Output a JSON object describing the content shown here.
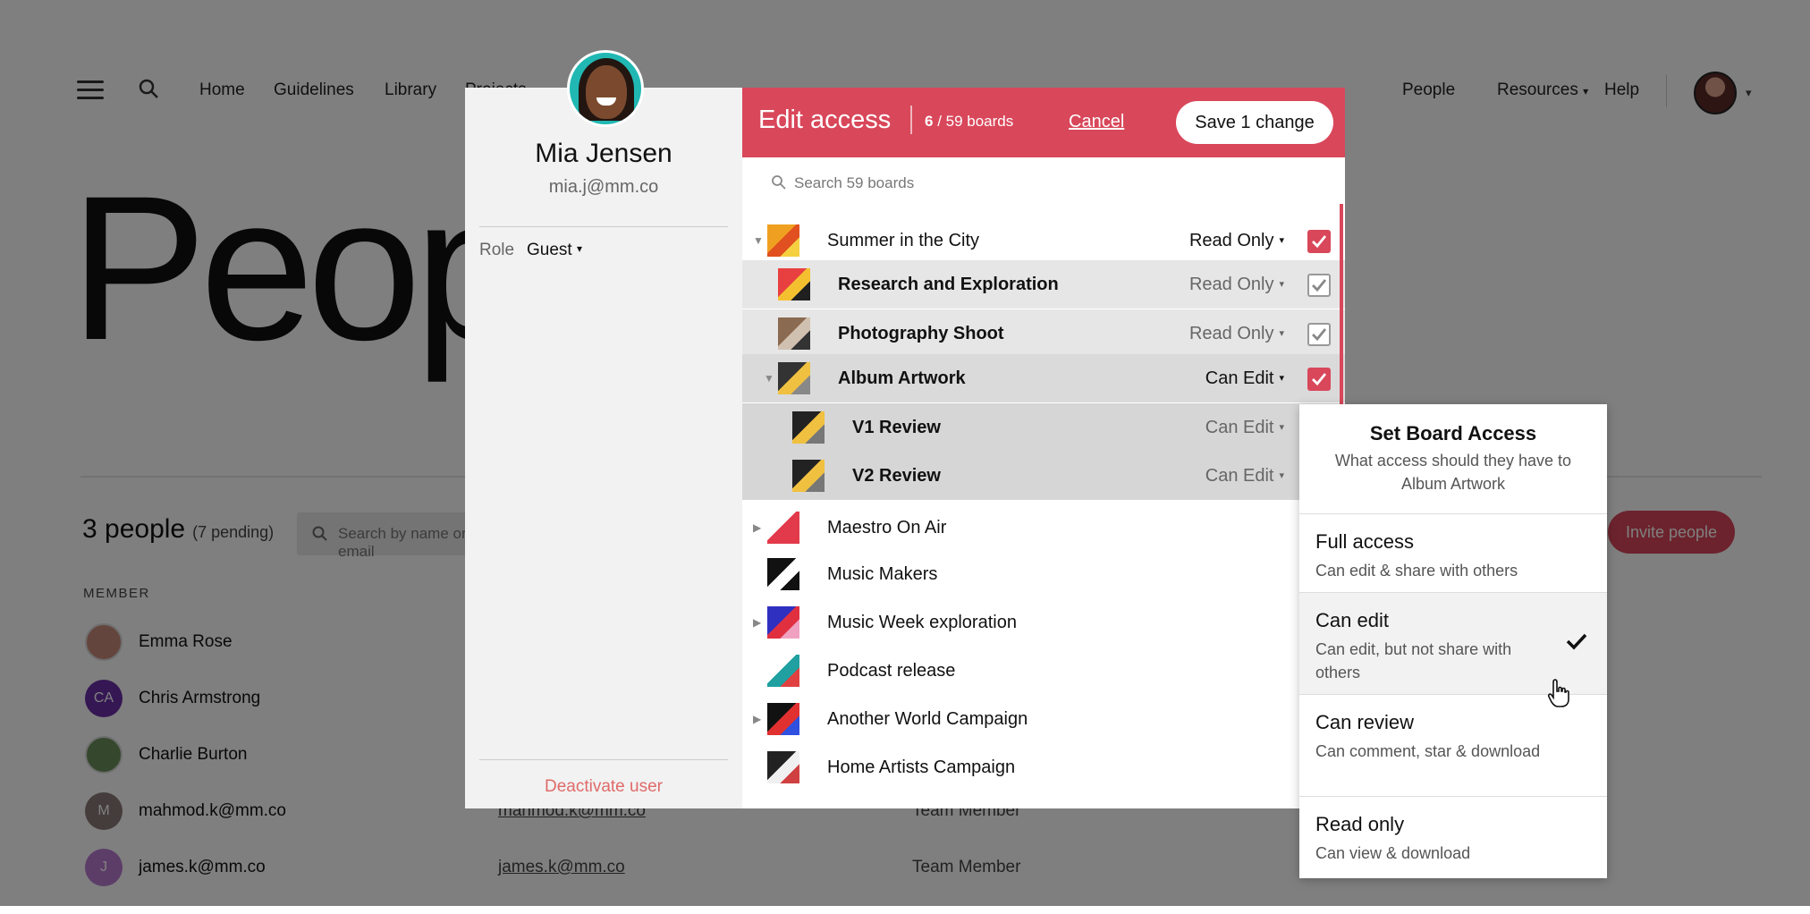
{
  "nav": {
    "links": [
      "Home",
      "Guidelines",
      "Library",
      "Projects"
    ],
    "right_links": [
      "People",
      "Resources",
      "Help"
    ]
  },
  "page": {
    "title": "People",
    "people_count": "3 people",
    "pending": "(7 pending)",
    "search_placeholder": "Search by name or email",
    "invite_label": "Invite people",
    "member_col": "MEMBER",
    "members": [
      {
        "name": "Emma Rose",
        "initials": "",
        "color": "#c98a7a",
        "email": "",
        "role": ""
      },
      {
        "name": "Chris Armstrong",
        "initials": "CA",
        "color": "#6a2fa8",
        "email": "",
        "role": ""
      },
      {
        "name": "Charlie Burton",
        "initials": "",
        "color": "#6a8f5a",
        "email": "",
        "role": ""
      },
      {
        "name": "mahmod.k@mm.co",
        "initials": "M",
        "color": "#8a7a78",
        "email": "mahmod.k@mm.co",
        "role": "Team Member"
      },
      {
        "name": "james.k@mm.co",
        "initials": "J",
        "color": "#b87ad0",
        "email": "james.k@mm.co",
        "role": "Team Member"
      }
    ]
  },
  "user": {
    "name": "Mia Jensen",
    "email": "mia.j@mm.co",
    "role_label": "Role",
    "role_value": "Guest",
    "deactivate": "Deactivate user"
  },
  "edit": {
    "title": "Edit access",
    "count_selected": "6",
    "count_total": " / 59 boards",
    "cancel": "Cancel",
    "save": "Save 1 change",
    "search_placeholder": "Search 59 boards"
  },
  "boards": [
    {
      "name": "Summer in the City",
      "perm": "Read Only",
      "check": "red",
      "expand": "open",
      "level": 0
    },
    {
      "name": "Research and Exploration",
      "perm": "Read Only",
      "check": "outline",
      "expand": "",
      "level": 1
    },
    {
      "name": "Photography Shoot",
      "perm": "Read Only",
      "check": "outline",
      "expand": "",
      "level": 1
    },
    {
      "name": "Album Artwork",
      "perm": "Can Edit",
      "check": "red",
      "expand": "open",
      "level": 1
    },
    {
      "name": "V1 Review",
      "perm": "Can Edit",
      "check": "",
      "expand": "",
      "level": 2
    },
    {
      "name": "V2 Review",
      "perm": "Can Edit",
      "check": "",
      "expand": "",
      "level": 2
    },
    {
      "name": "Maestro On Air",
      "perm": "",
      "check": "",
      "expand": "closed",
      "level": 0
    },
    {
      "name": "Music Makers",
      "perm": "",
      "check": "",
      "expand": "",
      "level": 0
    },
    {
      "name": "Music Week exploration",
      "perm": "",
      "check": "",
      "expand": "closed",
      "level": 0
    },
    {
      "name": "Podcast release",
      "perm": "",
      "check": "",
      "expand": "",
      "level": 0
    },
    {
      "name": "Another World Campaign",
      "perm": "",
      "check": "",
      "expand": "closed",
      "level": 0
    },
    {
      "name": "Home Artists Campaign",
      "perm": "",
      "check": "",
      "expand": "",
      "level": 0
    }
  ],
  "dropdown": {
    "title": "Set Board Access",
    "subtitle": "What access should they have to Album Artwork",
    "options": [
      {
        "title": "Full access",
        "desc": "Can edit & share with others",
        "selected": false
      },
      {
        "title": "Can edit",
        "desc": "Can edit, but not share with others",
        "selected": true
      },
      {
        "title": "Can review",
        "desc": "Can comment, star & download",
        "selected": false
      },
      {
        "title": "Read only",
        "desc": "Can view & download",
        "selected": false
      }
    ]
  },
  "colors": {
    "accent": "#d9475a",
    "modal_left_bg": "#f2f2f2",
    "selected_row_bg": "#dcdcdc"
  },
  "icons": [
    "hamburger-icon",
    "search-icon",
    "chevron-down-icon",
    "checkbox-icon",
    "check-icon",
    "hand-pointer-icon"
  ]
}
